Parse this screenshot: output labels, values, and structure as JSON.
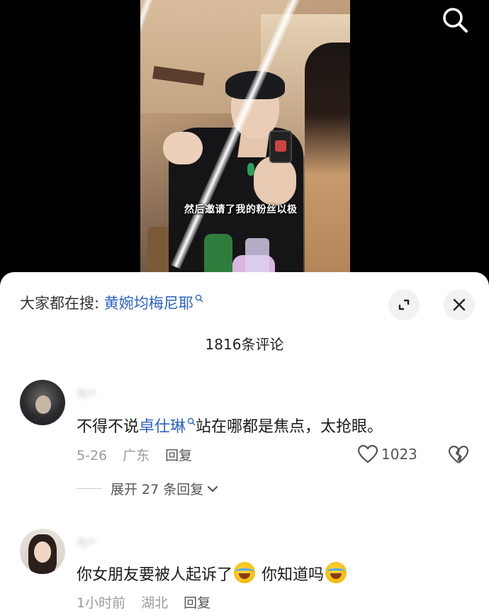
{
  "video": {
    "caption": "然后邀请了我的粉丝以极"
  },
  "sheet": {
    "trending_prefix": "大家都在搜: ",
    "trending_term": "黄婉均梅尼耶",
    "comment_count": "1816条评论"
  },
  "comments": [
    {
      "username": "用户",
      "text_before": "不得不说",
      "mention": "卓仕琳",
      "text_after": "站在哪都是焦点，太抢眼。",
      "date": "5-26",
      "location": "广东",
      "reply_label": "回复",
      "likes": "1023",
      "expand_label": "展开 27 条回复"
    },
    {
      "username": "用户",
      "text_part1": "你女朋友要被人起诉了",
      "text_part2": " 你知道吗",
      "date": "1小时前",
      "location": "湖北",
      "reply_label": "回复"
    }
  ],
  "colors": {
    "link": "#2b63c6",
    "meta": "#9a9a9a",
    "background": "#ffffff"
  },
  "icons": [
    "search-icon",
    "expand-icon",
    "close-icon",
    "heart-icon",
    "broken-heart-icon",
    "chevron-down-icon",
    "cry-laugh-emoji"
  ]
}
